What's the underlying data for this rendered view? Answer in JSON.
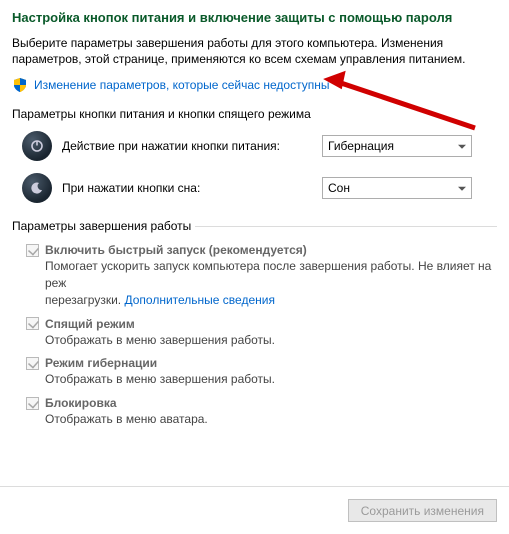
{
  "title": "Настройка кнопок питания и включение защиты с помощью пароля",
  "description": "Выберите параметры завершения работы для этого компьютера. Изменения параметров, этой странице, применяются ко всем схемам управления питанием.",
  "change_link": "Изменение параметров, которые сейчас недоступны",
  "buttons_section": "Параметры кнопки питания и кнопки спящего режима",
  "power_button": {
    "label": "Действие при нажатии кнопки питания:",
    "value": "Гибернация"
  },
  "sleep_button": {
    "label": "При нажатии кнопки сна:",
    "value": "Сон"
  },
  "shutdown_section": "Параметры завершения работы",
  "options": {
    "fast_startup": {
      "label": "Включить быстрый запуск (рекомендуется)",
      "desc_prefix": "Помогает ускорить запуск компьютера после завершения работы. Не влияет на реж",
      "desc_suffix": "перезагрузки. ",
      "more_link": "Дополнительные сведения"
    },
    "sleep": {
      "label": "Спящий режим",
      "desc": "Отображать в меню завершения работы."
    },
    "hibernate": {
      "label": "Режим гибернации",
      "desc": "Отображать в меню завершения работы."
    },
    "lock": {
      "label": "Блокировка",
      "desc": "Отображать в меню аватара."
    }
  },
  "save_button": "Сохранить изменения"
}
